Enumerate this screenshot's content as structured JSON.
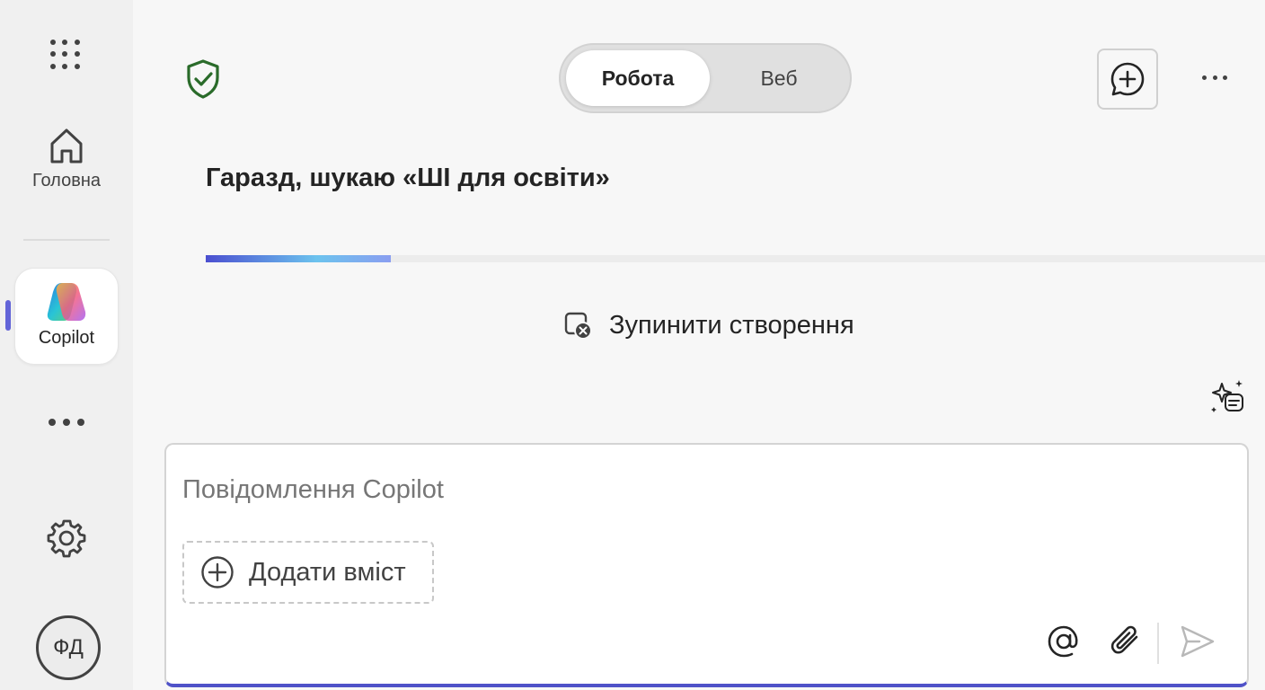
{
  "rail": {
    "home_label": "Головна",
    "copilot_label": "Copilot",
    "avatar_initials": "ФД"
  },
  "header": {
    "toggle_work": "Робота",
    "toggle_web": "Веб",
    "active_tab": "Робота"
  },
  "status": {
    "text": "Гаразд, шукаю «ШІ для освіти»",
    "progress": 0.175
  },
  "stop": {
    "label": "Зупинити створення"
  },
  "composer": {
    "placeholder": "Повідомлення Copilot",
    "value": "",
    "add_content_label": "Додати вміст"
  },
  "icons": {
    "apps": "app-launcher-icon",
    "home": "home-icon",
    "copilot": "copilot-logo-icon",
    "more": "more-horizontal-icon",
    "settings": "gear-icon",
    "shield": "shield-check-icon",
    "new_chat": "chat-add-icon",
    "stop": "stop-generating-icon",
    "prompts": "sparkle-list-icon",
    "add": "circle-plus-icon",
    "mention": "at-sign-icon",
    "attach": "paperclip-icon",
    "send": "send-icon"
  },
  "colors": {
    "accent": "#4f52c8",
    "shield": "#2a6b2a",
    "progress_start": "#4b4fd0",
    "progress_mid": "#6cc3ee"
  }
}
